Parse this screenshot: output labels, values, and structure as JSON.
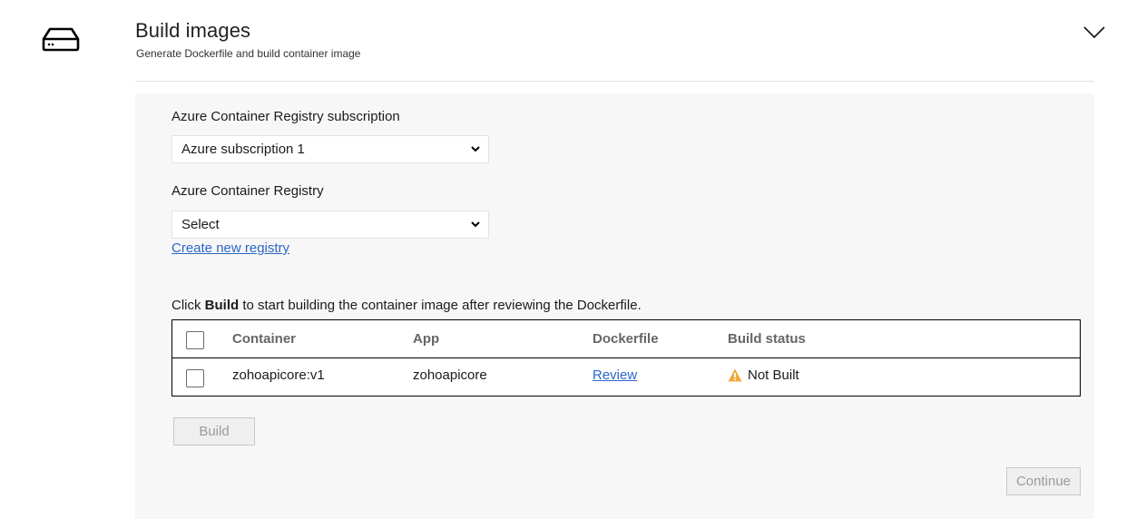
{
  "header": {
    "icon": "hard-drive-icon",
    "title": "Build images",
    "subtitle": "Generate Dockerfile and build container image",
    "collapse_icon": "chevron-down-icon"
  },
  "form": {
    "subscription": {
      "label": "Azure Container Registry subscription",
      "selected": "Azure subscription 1"
    },
    "registry": {
      "label": "Azure Container Registry",
      "selected": "Select",
      "create_link": "Create new registry"
    }
  },
  "instructions": {
    "prefix": "Click ",
    "bold": "Build",
    "suffix": " to start building the container image after reviewing the Dockerfile."
  },
  "table": {
    "columns": [
      "Container",
      "App",
      "Dockerfile",
      "Build status"
    ],
    "rows": [
      {
        "checked": false,
        "container": "zohoapicore:v1",
        "app": "zohoapicore",
        "dockerfile_link": "Review",
        "status": "Not Built",
        "status_icon": "warning-icon",
        "status_color": "#f2a93b"
      }
    ]
  },
  "buttons": {
    "build": "Build",
    "continue": "Continue"
  }
}
